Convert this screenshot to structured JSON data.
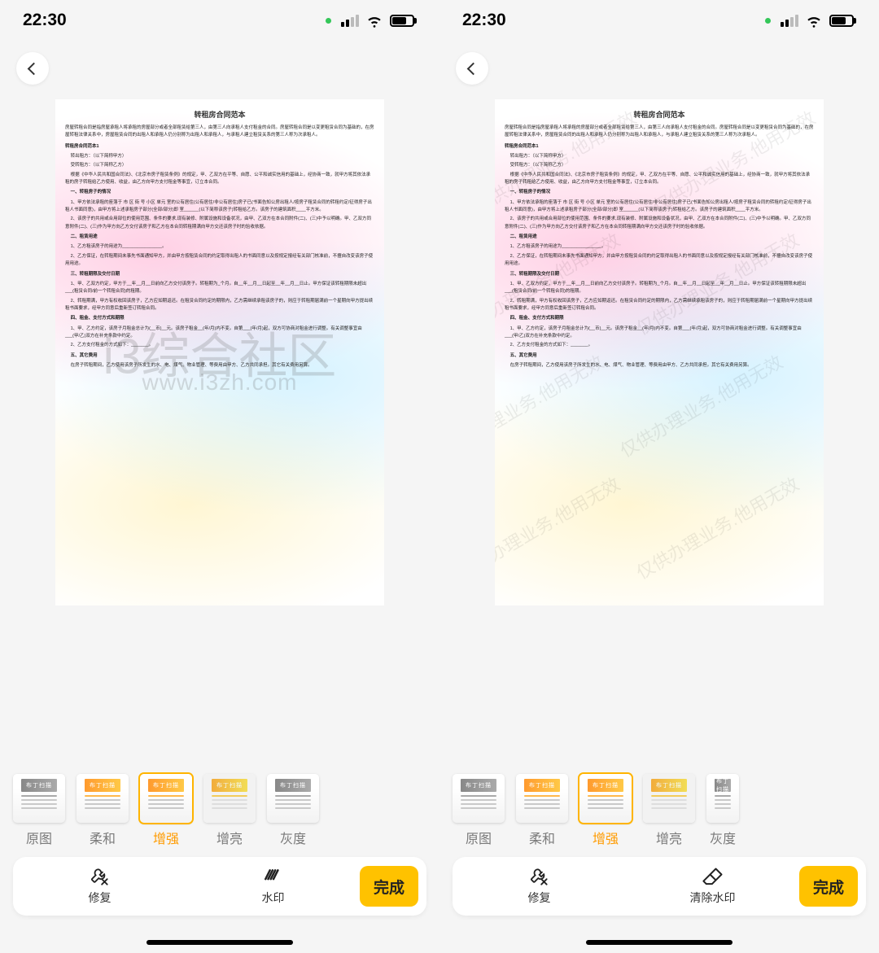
{
  "status": {
    "time": "22:30"
  },
  "doc": {
    "title": "转租房合同范本",
    "intro": "房屋转租合同是指房屋承租人将承租的房屋部分或者全部租赁给第三人，由第三人向承租人支付租金的合同。房屋转租合同是以变更租赁合同为基础的，在房屋转租法律关系中，房屋租赁合同的出租人和承租人仍分别称为出租人和承租人，与承租人建立租赁关系的第三人称为次承租人。",
    "red": "转租房合同范本1",
    "p1": "转出租方：（以下简称甲方）",
    "p2": "受转租方：（以下简称乙方）",
    "p3": "根据《中华人民共和国合同法》、《北京市房子租赁条例》的规定，甲、乙双方在平等、自愿、公平和诚实信用的基础上，经协商一致，就甲方将其依法承租的房子转租给乙方使用、收益，由乙方向甲方支付租金等事宜，订立本合同。",
    "s1": "一、转租房子的情况",
    "p4": "1、甲方依法承租的座落于 市 区 街 号 小区 单元 室的公有居住(公有居住/非公有居住)房子已(书面告知公房出租人/按房子租赁合同的转租约定/征得房子出租人书面同意)，由甲方将上述承租房子部分(全部/部分)即 室______(以下简称该房子)转租给乙方。该房子的建筑面积____平方米。",
    "p5": "2、该房子的共用或合用部位的使用范围、条件的要求,现有装修、附属设施和设备状况，由甲、乙双方在本合同附件(二)、(三)中予以明确。甲、乙双方同意附件(二)、(三)作为甲方向乙方交付该房子和乙方在本合同转租期满向甲方交还该房子时的验收依据。",
    "s2": "二、租赁用途",
    "p6": "1、乙方租该房子的用途为________________。",
    "p7": "2、乙方保证，在转租期间未事先书面通知甲方，并由甲方按租赁合同的约定取得出租人的书面同意以及按规定报经有关部门核准前，不擅自改变该房子使用用途。",
    "s3": "三、转租期限及交付日期",
    "p8": "1、甲、乙双方约定，甲方于__年__月__日前向乙方交付该房子。转租期为_个月。自__年__月__日起至__年__月__日止。甲方保证该转租期限未超出___(租赁合同/前一个转租合同)的租期。",
    "p9": "2、转租期满，甲方有权收回该房子，乙方应如期返还。在租赁合同约定的期限内，乙方需继续承租该房子的，则应于转租期届满前一个星期向甲方提出续租书面要求，经甲方同意后重新签订转租合同。",
    "s4": "四、租金、支付方式和期限",
    "p10": "1、甲、乙方约定，该房子月租金总计为(__币)__元。该房子租金__(年/月)内不变。自第___(年/月)起，双方可协商对租金进行调整。有关调整事宜由___(甲/乙)双方在补充条款中约定。",
    "p11": "2、乙方支付租金的方式如下：_______。",
    "s5": "五、其它费用",
    "p12": "在房子转租期间，乙方使用该房子所发生的水、电、煤气、物业管理、等费用由甲方、乙方共同承担。其它有关费用另算。"
  },
  "watermark_center": {
    "line1": "i3综合社区",
    "line2": "www.i3zh.com"
  },
  "watermark_diag": "仅供办理业务.他用无效",
  "filters": {
    "items": [
      {
        "label": "原图"
      },
      {
        "label": "柔和"
      },
      {
        "label": "增强"
      },
      {
        "label": "增亮"
      },
      {
        "label": "灰度"
      }
    ],
    "thumb_text": "布丁扫描"
  },
  "actions": {
    "repair": "修复",
    "watermark": "水印",
    "clear_watermark": "清除水印",
    "done": "完成"
  }
}
